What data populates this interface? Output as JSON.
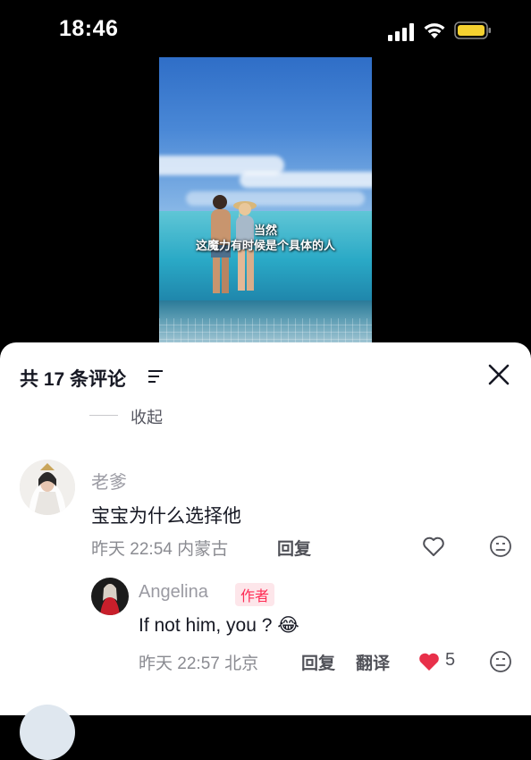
{
  "status_bar": {
    "time": "18:46",
    "icons": [
      "signal-icon",
      "wifi-icon",
      "battery-icon"
    ],
    "battery_color": "#f5d130"
  },
  "video": {
    "caption_line1": "当然",
    "caption_line2": "这魔力有时候是个具体的人"
  },
  "comments_panel": {
    "title": "共 17 条评论",
    "collapse_label": "收起",
    "comments": [
      {
        "username": "老爹",
        "text": "宝宝为什么选择他",
        "time": "昨天 22:54",
        "location": "内蒙古",
        "reply_label": "回复"
      },
      {
        "username": "Angelina",
        "badge": "作者",
        "text": "If not him, you ? 😂",
        "time": "昨天 22:57",
        "location": "北京",
        "reply_label": "回复",
        "translate_label": "翻译",
        "like_count": "5"
      }
    ]
  },
  "colors": {
    "accent": "#fe2c55",
    "like_heart": "#e8304a",
    "text_primary": "#161823",
    "text_secondary": "#8a8b91"
  }
}
